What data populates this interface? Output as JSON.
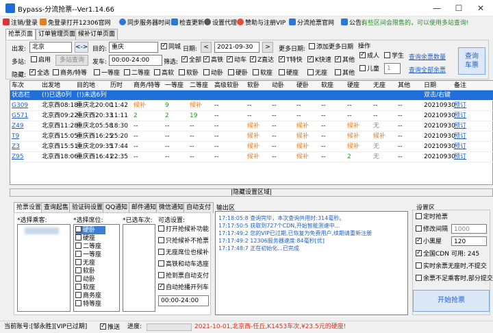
{
  "window": {
    "title": "Bypass-分流抢票--Ver1.14.66",
    "min": "—",
    "max": "☐",
    "close": "✕"
  },
  "toolbar": [
    {
      "label": "注销/登录",
      "icon": "logout-icon",
      "color": "#d33"
    },
    {
      "label": "免登录打开12306官网",
      "icon": "browser-icon",
      "color": "#e67e22"
    },
    {
      "label": "同步服务器时间",
      "icon": "clock-icon",
      "color": "#2a7ad5"
    },
    {
      "label": "检查更新",
      "icon": "update-icon",
      "color": "#2a7ad5"
    },
    {
      "label": "设置代理",
      "icon": "proxy-icon",
      "color": "#555"
    },
    {
      "label": "赞助与注册VIP",
      "icon": "heart-icon",
      "color": "#e74c3c"
    },
    {
      "label": "分流抢票官网",
      "icon": "home-icon",
      "color": "#2a7ad5"
    },
    {
      "label": "公告:",
      "icon": "notice-icon",
      "color": "#2a7ad5"
    }
  ],
  "announcement": "有些区间会限售的，可以使用多站查询!",
  "tabs": [
    "抢票页面",
    "订单管理页面",
    "候补订单页面"
  ],
  "query": {
    "from_label": "出发:",
    "from": "北京",
    "swap": "<->",
    "to_label": "目的:",
    "to": "重庆",
    "same_city": "同城",
    "date_label": "日期:",
    "date": "2021-09-30",
    "prev": "<",
    "next": ">",
    "more_dates_label": "更多日期:",
    "add_more_dates": "添加更多日期",
    "multi_label": "多站:",
    "multi_enable": "启用",
    "multi_query": "多站查询",
    "depart_label": "发车:",
    "depart_time": "00:00-24:00",
    "filter_label": "筛选:",
    "filters": [
      "全部",
      "高铁",
      "动车",
      "Z直达",
      "T特快",
      "K快速",
      "其他"
    ],
    "hide_label": "隐藏:",
    "hides": [
      "全选",
      "商务/特等",
      "一等座",
      "二等座",
      "高软",
      "软卧",
      "动卧",
      "硬卧",
      "软座",
      "硬座",
      "无座",
      "其他"
    ],
    "ops_label": "操作",
    "adult": "成人",
    "student": "学生",
    "child": "儿童",
    "child_count": "1",
    "link1": "查询余票数量",
    "link2": "查询全部余票",
    "search": "查询\n车票"
  },
  "grid": {
    "headers": [
      "车次",
      "出发地",
      "目的地",
      "历时",
      "商务/特等",
      "一等座",
      "二等座",
      "高级软卧",
      "软卧",
      "动卧",
      "硬卧",
      "软座",
      "硬座",
      "无座",
      "其他",
      "日期",
      "备注"
    ],
    "rows": [
      {
        "cells": [
          "状态栏",
          "(!)已选0列",
          "(!)未选6列",
          "",
          "",
          "",
          "",
          "",
          "",
          "",
          "",
          "",
          "",
          "",
          "",
          "双击/右键",
          ""
        ],
        "sel": true
      },
      {
        "cells": [
          "G309",
          "北京西08:18",
          "重庆北20:00",
          "11:42",
          "候补",
          "9",
          "候补",
          "--",
          "--",
          "--",
          "--",
          "--",
          "--",
          "--",
          "--",
          "20210930",
          "预订"
        ]
      },
      {
        "cells": [
          "G571",
          "北京西09:22",
          "重庆西20:33",
          "11:11",
          "2",
          "2",
          "19",
          "--",
          "--",
          "--",
          "--",
          "--",
          "--",
          "--",
          "--",
          "20210930",
          "预订"
        ]
      },
      {
        "cells": [
          "Z49",
          "北京西11:28",
          "重庆北05:58",
          "18:30",
          "--",
          "--",
          "--",
          "--",
          "候补",
          "--",
          "候补",
          "--",
          "候补",
          "无",
          "--",
          "20210930",
          "预订"
        ]
      },
      {
        "cells": [
          "T9",
          "北京西15:05",
          "重庆西16:25",
          "25:20",
          "--",
          "--",
          "--",
          "--",
          "候补",
          "--",
          "候补",
          "--",
          "候补",
          "候补",
          "--",
          "20210930",
          "预订"
        ]
      },
      {
        "cells": [
          "Z3",
          "北京西15:51",
          "重庆北09:35",
          "17:44",
          "--",
          "--",
          "--",
          "--",
          "候补",
          "--",
          "候补",
          "--",
          "候补",
          "无",
          "--",
          "20210930",
          "预订"
        ]
      },
      {
        "cells": [
          "Z95",
          "北京西18:06",
          "重庆西16:41",
          "22:35",
          "--",
          "--",
          "--",
          "--",
          "候补",
          "--",
          "候补",
          "--",
          "2",
          "无",
          "--",
          "20210930",
          "预订"
        ]
      }
    ]
  },
  "hide_bar": "|隐藏设置区域|",
  "bottom_tabs": [
    "抢票设置",
    "查询起售",
    "验证码设置",
    "QQ通知",
    "邮件通知",
    "微信通知",
    "自动支付"
  ],
  "settings": {
    "passenger_label": "*选择乘客:",
    "seat_label": "*选择席位:",
    "train_label": "*已选车次:",
    "options_label": "可选设置:",
    "seats": [
      "硬卧",
      "硬座",
      "二等座",
      "一等座",
      "无座",
      "软卧",
      "动卧",
      "软座",
      "商务座",
      "特等座"
    ],
    "options": [
      "打开抢候补功能",
      "只抢候补不抢票",
      "无座席位也候补",
      "高铁和动车选座",
      "抢到票自动支付",
      "自动抢播开列车"
    ],
    "option_time": "00:00-24:00"
  },
  "output": {
    "label": "输出区",
    "lines": [
      {
        "time": "17:18:05:8",
        "text": "查询完毕，本次查询共用时:314毫秒。"
      },
      {
        "time": "17:17:50:5",
        "text": "获取到727个CDN,开始智能测速中..."
      },
      {
        "time": "17:17:49:2",
        "text": "您的VIP已过期,已恢复为免费用户,续期请重新注册"
      },
      {
        "time": "17:17:49:2",
        "text": "12306服务器速度:84毫秒[优]"
      },
      {
        "time": "17:17:48:7",
        "text": "正在初始化...已完成"
      }
    ]
  },
  "setting_area": {
    "label": "设置区",
    "items": [
      {
        "label": "定时抢票",
        "value": "",
        "checked": false
      },
      {
        "label": "修改间隔",
        "value": "1000",
        "checked": false
      },
      {
        "label": "小黑屋",
        "value": "120",
        "checked": true
      },
      {
        "label": "全国CDN",
        "value": "可用: 245",
        "checked": true
      },
      {
        "label": "实时余票无座时,不提交",
        "value": "",
        "checked": false
      },
      {
        "label": "余票不足乘客时,部分提交",
        "value": "",
        "checked": false
      }
    ],
    "start": "开始抢票"
  },
  "status": {
    "account": "当前账号:[邹永胜][VIP已过期]",
    "push": "推送",
    "progress": "进度:",
    "ticker": "2021-10-01,北京西-任丘,K1453车次,¥23.5元的硬座!"
  }
}
